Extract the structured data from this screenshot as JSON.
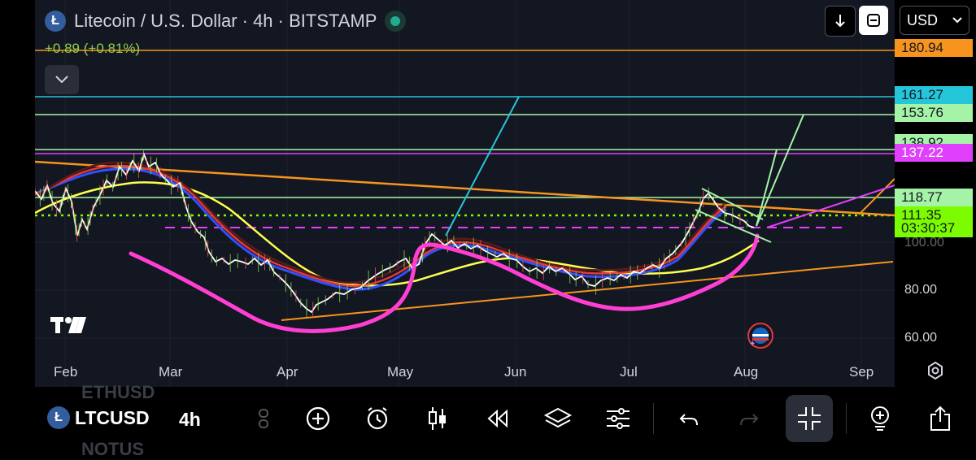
{
  "header": {
    "title": "Litecoin / U.S. Dollar · 4h · BITSTAMP",
    "logo_letter": "Ł",
    "change": "+0.89 (+0.81%)",
    "currency": "USD"
  },
  "price_labels": [
    {
      "text": "180.94",
      "bg": "#f7941d",
      "color": "#131722",
      "y": 180.94
    },
    {
      "text": "161.27",
      "bg": "#26c6da",
      "color": "#131722",
      "y": 161.27
    },
    {
      "text": "153.76",
      "bg": "#a5f3a7",
      "color": "#131722",
      "y": 153.76
    },
    {
      "text": "138.92",
      "bg": "#a5f3a7",
      "color": "#131722",
      "y": 141.3
    },
    {
      "text": "137.22",
      "bg": "#e040fb",
      "color": "#ffffff",
      "y": 137.22
    },
    {
      "text": "118.77",
      "bg": "#a5f3a7",
      "color": "#131722",
      "y": 118.77
    },
    {
      "text": "111.35",
      "bg": "#7cfc00",
      "color": "#131722",
      "y": 111.35
    },
    {
      "text": "03:30:37",
      "bg": "#7cfc00",
      "color": "#131722",
      "y": 105.9
    }
  ],
  "y_axis_ticks": [
    "100.00",
    "80.00",
    "60.00"
  ],
  "x_axis_labels": [
    "Feb",
    "Mar",
    "Apr",
    "May",
    "Jun",
    "Jul",
    "Aug",
    "Sep"
  ],
  "colors": {
    "background": "#131722",
    "orange": "#f7941d",
    "cyan": "#26c6da",
    "mint": "#a5f3a7",
    "magenta": "#e040fb",
    "green": "#7cfc00",
    "yellow": "#ffff4d"
  },
  "toolbar": {
    "symbol": "LTCUSD",
    "ghost_above": "ETHUSD",
    "ghost_below": "NOTUS",
    "interval": "4h",
    "icons": [
      "indicators-icon",
      "add-icon",
      "alert-clock-icon",
      "candles-icon",
      "replay-icon",
      "layers-icon",
      "settings-sliders-icon",
      "undo-icon",
      "redo-icon",
      "fullscreen-exit-icon",
      "idea-bulb-icon",
      "share-icon"
    ]
  }
}
